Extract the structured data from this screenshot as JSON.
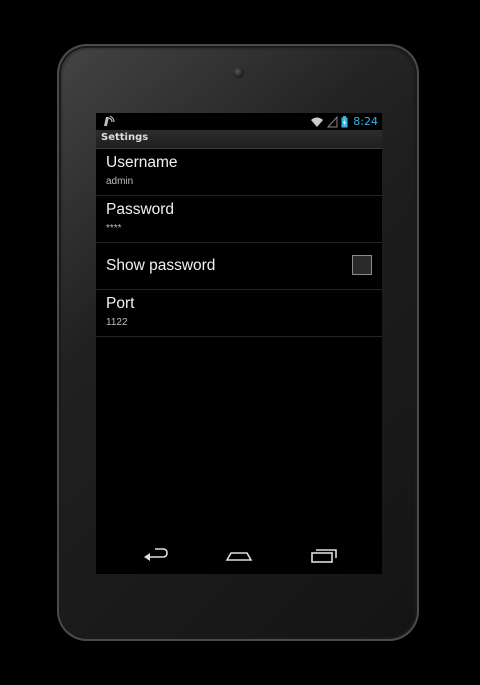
{
  "status_bar": {
    "time": "8:24",
    "icons": [
      "notification-icon",
      "wifi-icon",
      "signal-icon",
      "battery-charging-icon"
    ],
    "time_color": "#33b5e5"
  },
  "title_bar": {
    "title": "Settings"
  },
  "preferences": [
    {
      "title": "Username",
      "summary": "admin"
    },
    {
      "title": "Password",
      "summary": "****"
    },
    {
      "title": "Show password",
      "checked": false
    },
    {
      "title": "Port",
      "summary": "1122"
    }
  ],
  "nav_bar": {
    "buttons": [
      "back-icon",
      "home-icon",
      "recent-apps-icon"
    ]
  }
}
